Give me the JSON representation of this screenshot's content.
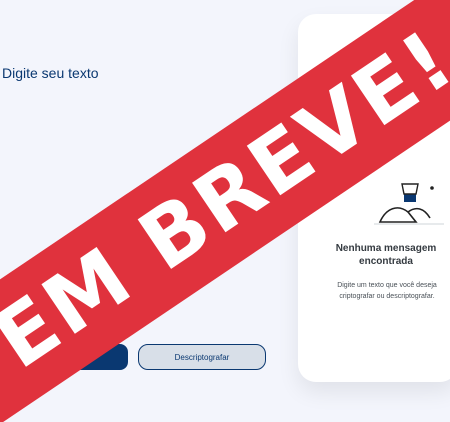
{
  "input": {
    "placeholder": "Digite seu texto"
  },
  "buttons": {
    "encrypt_label": "",
    "decrypt_label": "Descriptografar"
  },
  "output_panel": {
    "empty_title": "Nenhuma mensagem encontrada",
    "empty_description": "Digite um texto que você deseja criptografar ou descriptografar."
  },
  "overlay": {
    "banner_text": "EM BREVE!"
  },
  "colors": {
    "primary": "#0a3871",
    "background": "#f3f5fc",
    "banner": "#e0323d"
  },
  "icons": [
    "person-searching-illustration"
  ]
}
